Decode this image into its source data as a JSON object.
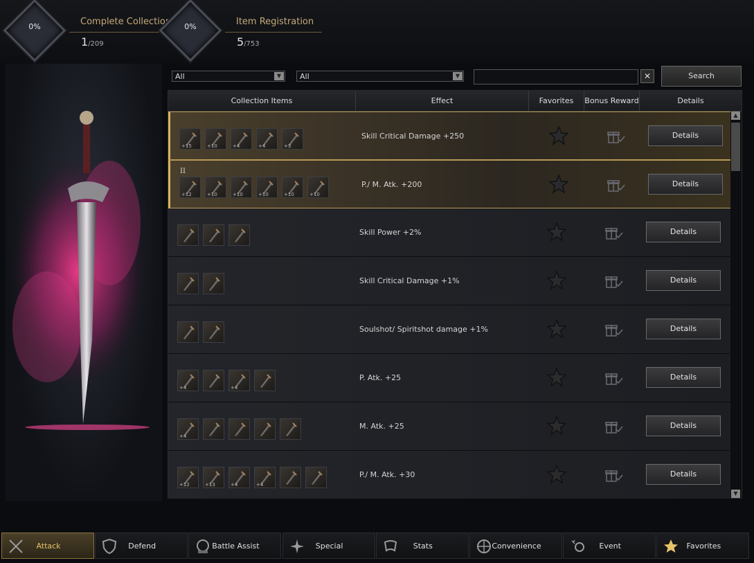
{
  "stats": [
    {
      "percent": "0%",
      "title": "Complete Collection",
      "value": "1",
      "total": "/209"
    },
    {
      "percent": "0%",
      "title": "Item Registration",
      "value": "5",
      "total": "/753"
    }
  ],
  "filters": {
    "filter1": "All",
    "filter2": "All",
    "search_placeholder": "",
    "clear_label": "✕",
    "search_label": "Search"
  },
  "table": {
    "headers": [
      "Collection Items",
      "Effect",
      "Favorites",
      "Bonus Reward",
      "Details"
    ],
    "rows": [
      {
        "tier": "",
        "effect": "Skill Critical Damage +250",
        "details": "Details",
        "selected": true,
        "items": [
          {
            "lvl": "+15"
          },
          {
            "lvl": "+10"
          },
          {
            "lvl": "+4"
          },
          {
            "lvl": "+4"
          },
          {
            "lvl": "+3"
          }
        ]
      },
      {
        "tier": "II",
        "effect": "P./ M. Atk. +200",
        "details": "Details",
        "selected": true,
        "items": [
          {
            "lvl": "+12"
          },
          {
            "lvl": "+10"
          },
          {
            "lvl": "+10"
          },
          {
            "lvl": "+10"
          },
          {
            "lvl": "+10"
          },
          {
            "lvl": "+10"
          }
        ]
      },
      {
        "tier": "",
        "effect": "Skill Power +2%",
        "details": "Details",
        "selected": false,
        "items": [
          {
            "lvl": ""
          },
          {
            "lvl": ""
          },
          {
            "lvl": ""
          }
        ]
      },
      {
        "tier": "",
        "effect": "Skill Critical Damage +1%",
        "details": "Details",
        "selected": false,
        "items": [
          {
            "lvl": ""
          },
          {
            "lvl": ""
          }
        ]
      },
      {
        "tier": "",
        "effect": "Soulshot/ Spiritshot damage +1%",
        "details": "Details",
        "selected": false,
        "items": [
          {
            "lvl": ""
          },
          {
            "lvl": ""
          }
        ]
      },
      {
        "tier": "",
        "effect": "P. Atk. +25",
        "details": "Details",
        "selected": false,
        "items": [
          {
            "lvl": "+4"
          },
          {
            "lvl": ""
          },
          {
            "lvl": "+4"
          },
          {
            "lvl": ""
          }
        ]
      },
      {
        "tier": "",
        "effect": "M. Atk. +25",
        "details": "Details",
        "selected": false,
        "items": [
          {
            "lvl": "+4"
          },
          {
            "lvl": ""
          },
          {
            "lvl": ""
          },
          {
            "lvl": ""
          },
          {
            "lvl": ""
          }
        ]
      },
      {
        "tier": "",
        "effect": "P./ M. Atk. +30",
        "details": "Details",
        "selected": false,
        "items": [
          {
            "lvl": "+12"
          },
          {
            "lvl": "+13"
          },
          {
            "lvl": "+4"
          },
          {
            "lvl": "+4"
          },
          {
            "lvl": ""
          },
          {
            "lvl": ""
          }
        ]
      }
    ]
  },
  "tabs": [
    {
      "label": "Attack",
      "icon": "swords-icon",
      "active": true
    },
    {
      "label": "Defend",
      "icon": "shield-icon",
      "active": false
    },
    {
      "label": "Battle Assist",
      "icon": "helmet-icon",
      "active": false
    },
    {
      "label": "Special",
      "icon": "sparkle-icon",
      "active": false
    },
    {
      "label": "Stats",
      "icon": "scroll-icon",
      "active": false
    },
    {
      "label": "Convenience",
      "icon": "globe-icon",
      "active": false
    },
    {
      "label": "Event",
      "icon": "party-icon",
      "active": false
    },
    {
      "label": "Favorites",
      "icon": "star-icon",
      "active": false
    }
  ],
  "colors": {
    "accent": "#d8b45a",
    "gold_text": "#c6a97a"
  }
}
